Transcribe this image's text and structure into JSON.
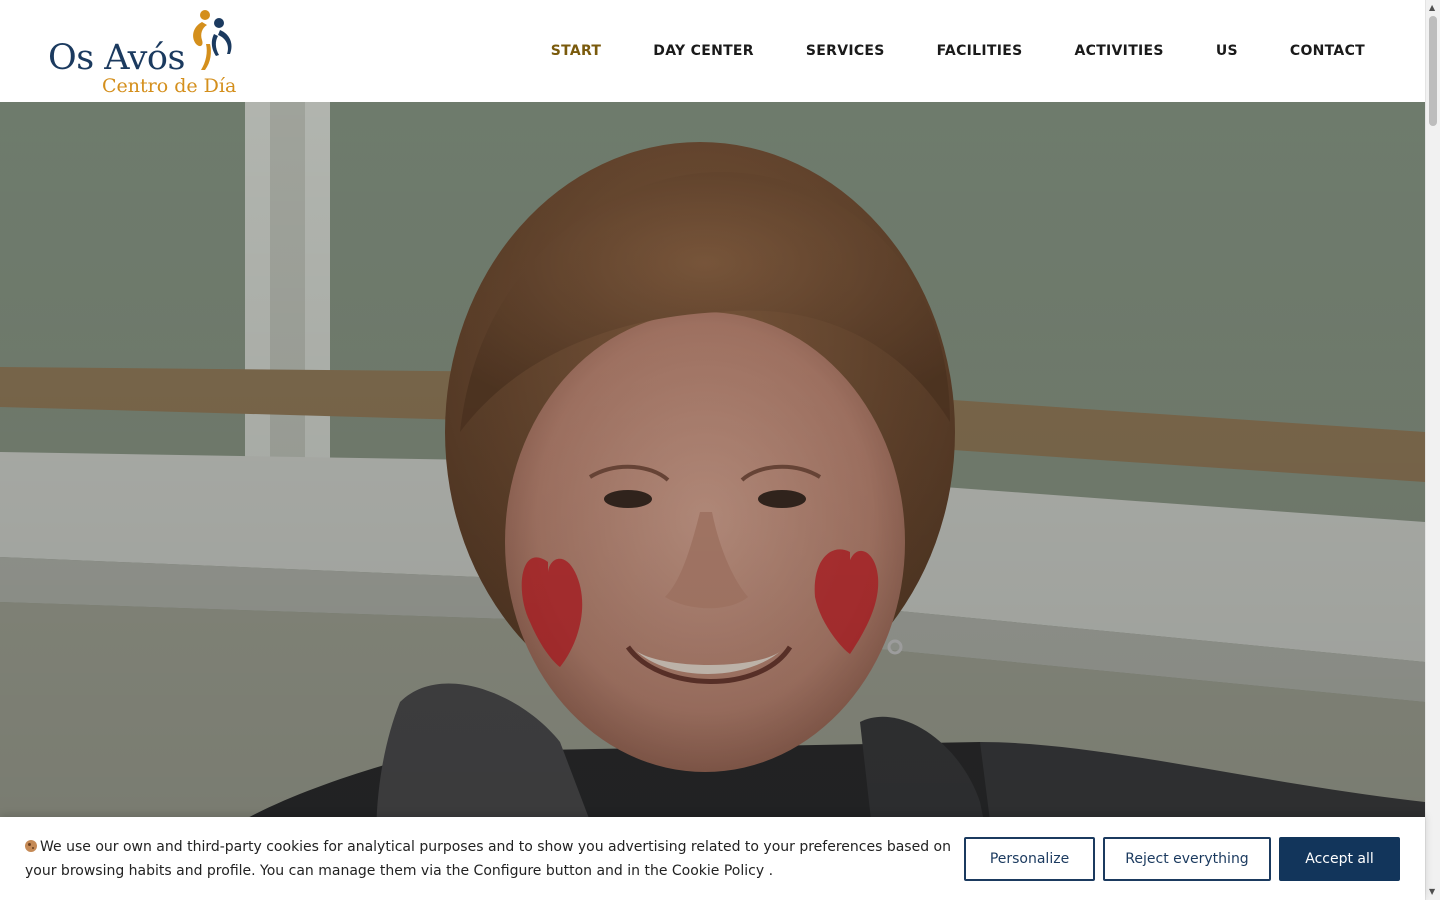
{
  "logo": {
    "title": "Os Avós",
    "subtitle": "Centro de Día"
  },
  "nav": {
    "items": [
      {
        "label": "START",
        "active": true
      },
      {
        "label": "DAY CENTER"
      },
      {
        "label": "SERVICES"
      },
      {
        "label": "FACILITIES"
      },
      {
        "label": "ACTIVITIES"
      },
      {
        "label": "US"
      },
      {
        "label": "CONTACT"
      }
    ]
  },
  "hero": {
    "image": "smiling elderly woman with red hearts painted on her cheeks"
  },
  "cookie": {
    "icon": "cookie-icon",
    "text": "We use our own and third-party cookies for analytical purposes and to show you advertising related to your preferences based on your browsing habits and profile. You can manage them via the Configure button and in the Cookie Policy .",
    "personalize_label": "Personalize",
    "reject_label": "Reject everything",
    "accept_label": "Accept all"
  },
  "colors": {
    "brand_navy": "#1b3a5f",
    "brand_gold": "#d48f1c",
    "nav_active": "#7a5a0c",
    "accept_bg": "#12355b"
  }
}
